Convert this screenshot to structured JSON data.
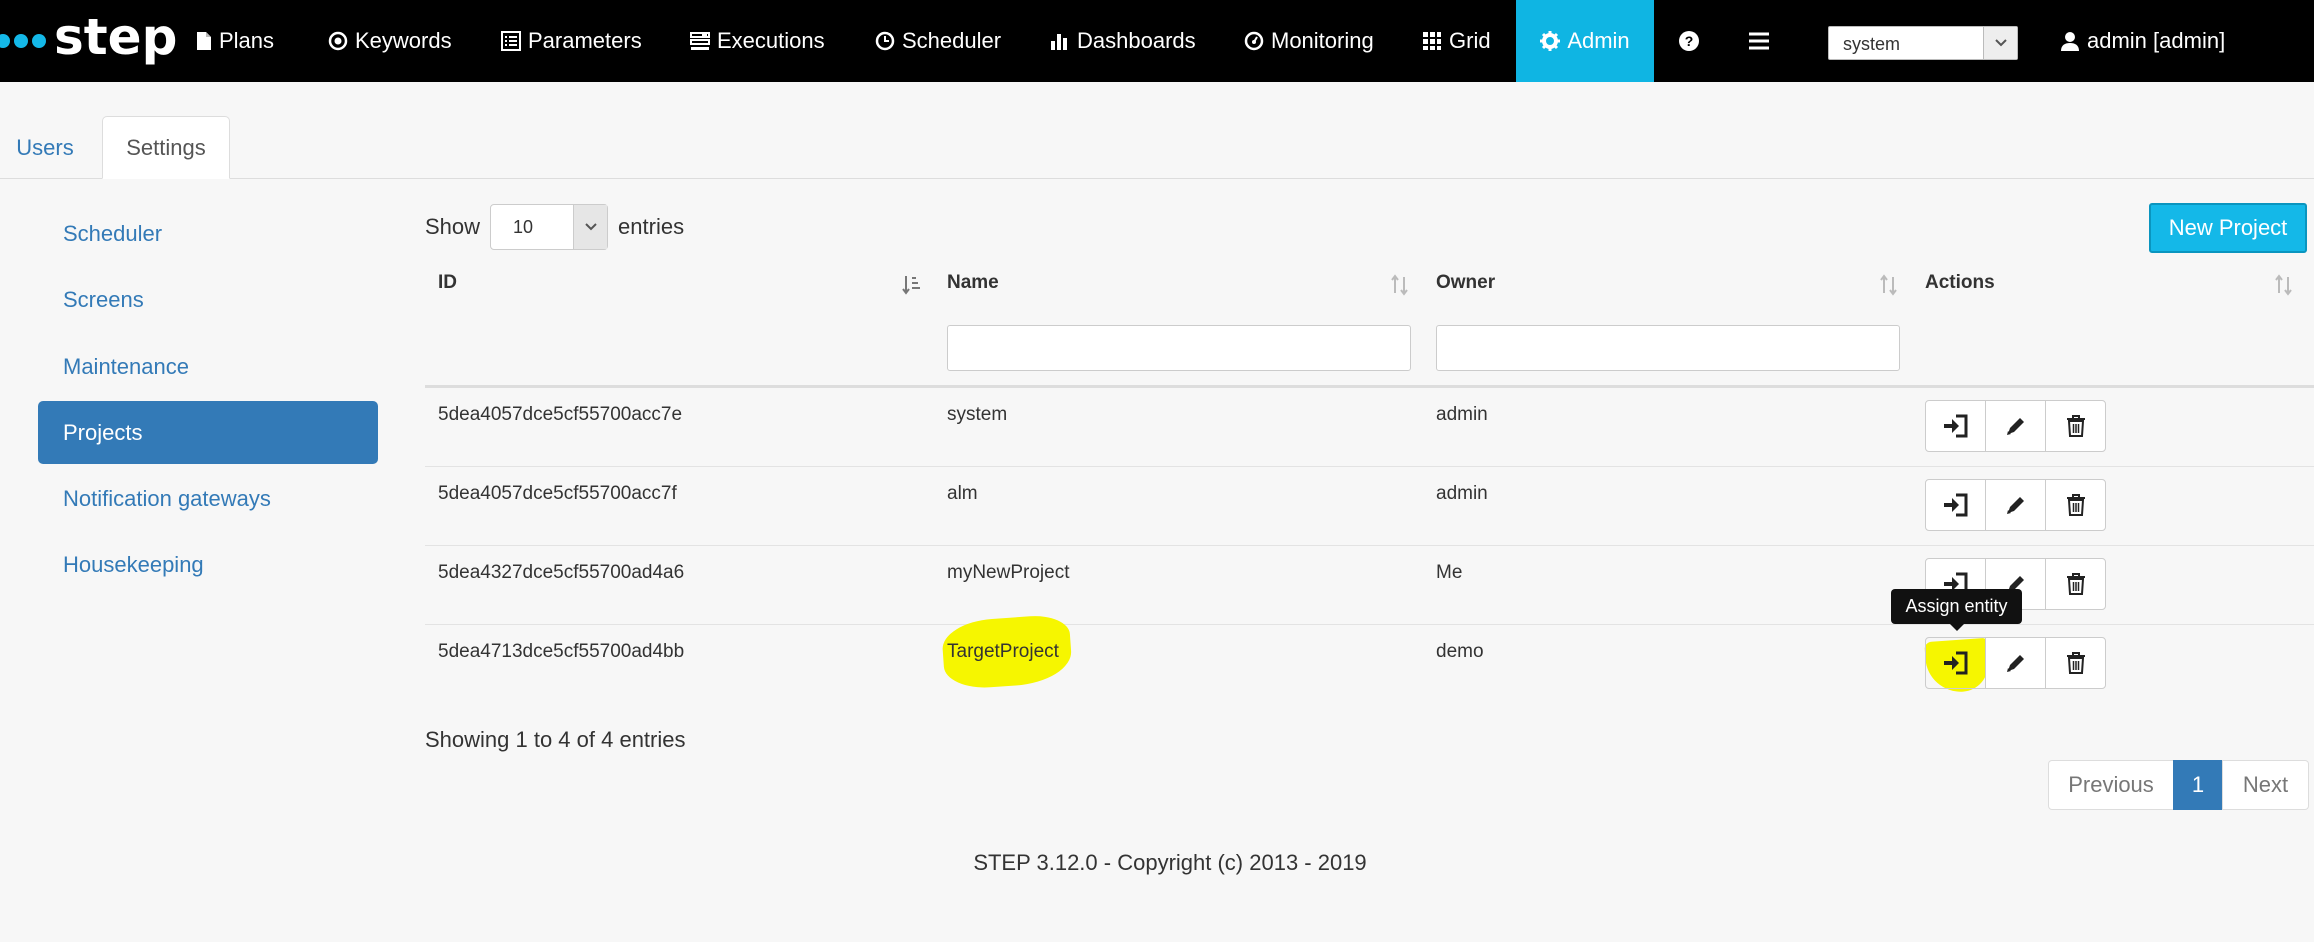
{
  "app": {
    "logo_text": "step",
    "nav": [
      {
        "label": "Plans",
        "icon": "file-icon"
      },
      {
        "label": "Keywords",
        "icon": "target-icon"
      },
      {
        "label": "Parameters",
        "icon": "list-icon"
      },
      {
        "label": "Executions",
        "icon": "tasks-icon"
      },
      {
        "label": "Scheduler",
        "icon": "clock-icon"
      },
      {
        "label": "Dashboards",
        "icon": "bar-chart-icon"
      },
      {
        "label": "Monitoring",
        "icon": "dashboard-icon"
      },
      {
        "label": "Grid",
        "icon": "grid-icon"
      },
      {
        "label": "Admin",
        "icon": "gear-icon",
        "active": true
      }
    ],
    "help_icon": "question-circle-icon",
    "menu_icon": "hamburger-icon",
    "project_select": "system",
    "user_label": "admin [admin]",
    "accent_color": "#0fb5e3"
  },
  "tabs": [
    "Users",
    "Settings"
  ],
  "active_tab": "Settings",
  "sidebar": {
    "items": [
      "Scheduler",
      "Screens",
      "Maintenance",
      "Projects",
      "Notification gateways",
      "Housekeeping"
    ],
    "active": "Projects"
  },
  "table": {
    "show_label": "Show",
    "entries_label": "entries",
    "page_length": "10",
    "new_button": "New Project",
    "columns": [
      "ID",
      "Name",
      "Owner",
      "Actions"
    ],
    "rows": [
      {
        "id": "5dea4057dce5cf55700acc7e",
        "name": "system",
        "owner": "admin"
      },
      {
        "id": "5dea4057dce5cf55700acc7f",
        "name": "alm",
        "owner": "admin"
      },
      {
        "id": "5dea4327dce5cf55700ad4a6",
        "name": "myNewProject",
        "owner": "Me"
      },
      {
        "id": "5dea4713dce5cf55700ad4bb",
        "name": "TargetProject",
        "owner": "demo"
      }
    ],
    "action_icons": [
      "sign-in-icon",
      "pencil-icon",
      "trash-icon"
    ],
    "tooltip": "Assign entity",
    "info": "Showing 1 to 4 of 4 entries",
    "pagination": {
      "previous": "Previous",
      "current": "1",
      "next": "Next"
    }
  },
  "highlight_color": "#f6f600",
  "footer": "STEP 3.12.0 - Copyright (c) 2013 - 2019"
}
